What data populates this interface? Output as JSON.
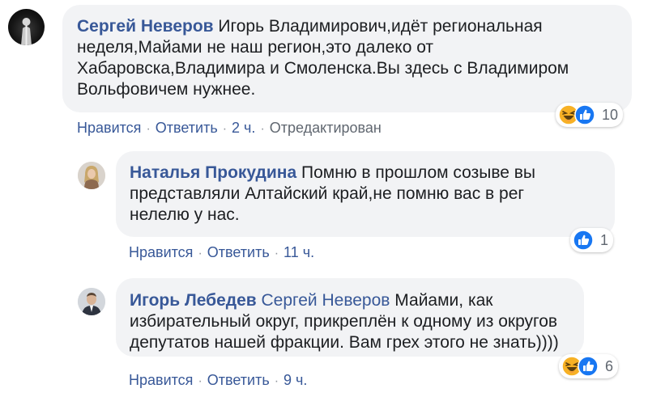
{
  "comments": [
    {
      "author": "Сергей Неверов",
      "lines": [
        "Игорь Владимирович,идёт региональная",
        "неделя,Майами не наш регион,это далеко от",
        "Хабаровска,Владимира и Смоленска.Вы здесь с Владимиром",
        "Вольфовичем нужнее."
      ],
      "actions": {
        "like": "Нравится",
        "reply": "Ответить",
        "time": "2 ч.",
        "edited": "Отредактирован"
      },
      "reactions": {
        "icons": [
          "haha-icon",
          "like-icon"
        ],
        "count": "10"
      }
    },
    {
      "author": "Наталья Прокудина",
      "lines": [
        "Помню в прошлом созыве вы",
        "представляли Алтайский край,не помню вас в рег",
        "нелелю у нас."
      ],
      "actions": {
        "like": "Нравится",
        "reply": "Ответить",
        "time": "11 ч."
      },
      "reactions": {
        "icons": [
          "like-icon"
        ],
        "count": "1"
      }
    },
    {
      "author": "Игорь Лебедев",
      "mention": "Сергей Неверов",
      "lines": [
        "Майами, как",
        "избирательный округ, прикреплён к одному из округов",
        "депутатов нашей фракции. Вам грех этого не знать))))"
      ],
      "actions": {
        "like": "Нравится",
        "reply": "Ответить",
        "time": "9 ч."
      },
      "reactions": {
        "icons": [
          "haha-icon",
          "like-icon"
        ],
        "count": "6"
      }
    }
  ],
  "separator": "·",
  "colors": {
    "link": "#385898",
    "bubble": "#f2f3f5",
    "meta": "#606770",
    "like_blue": "#1877f2",
    "haha_yellow": "#f7b125"
  }
}
